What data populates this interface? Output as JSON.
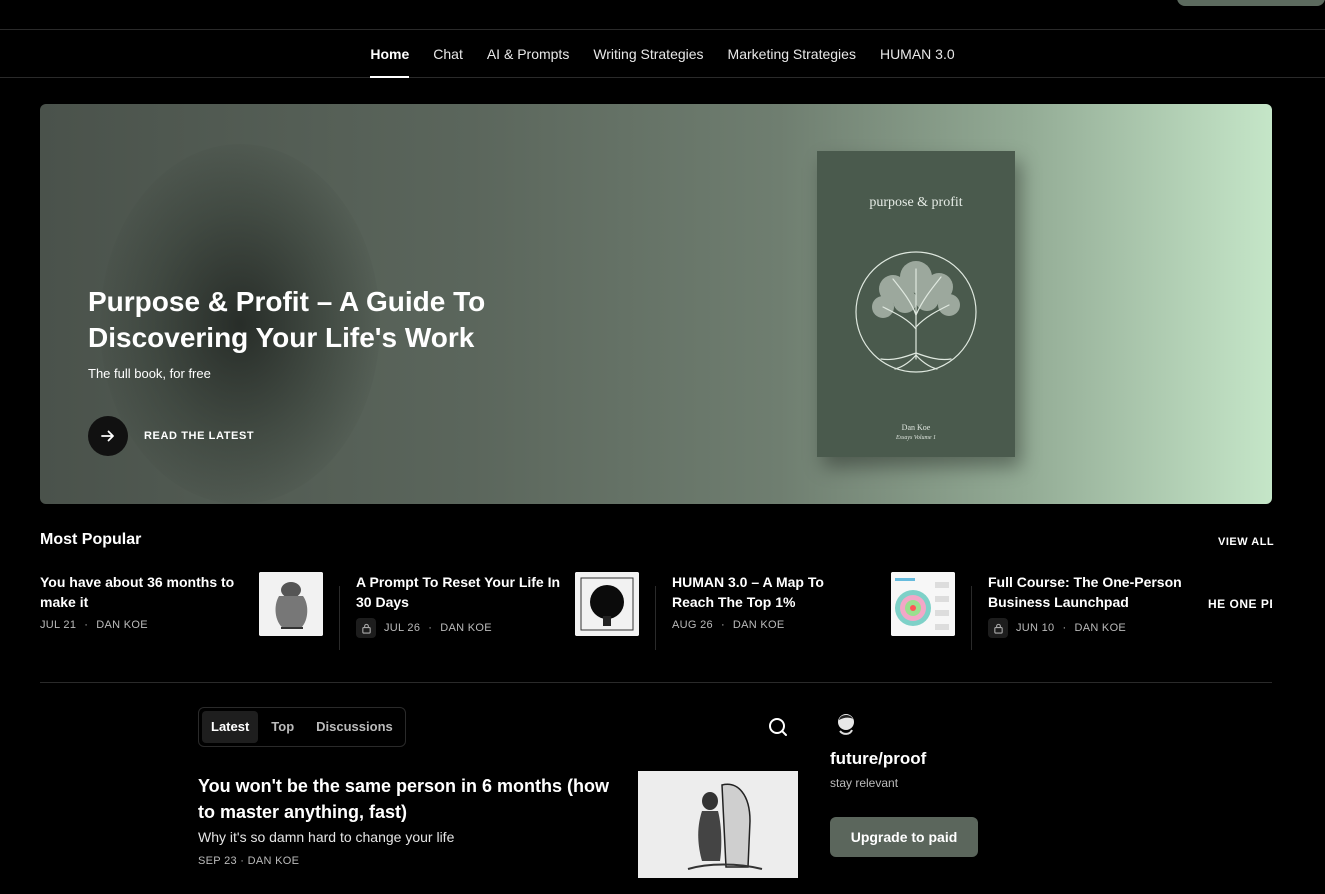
{
  "nav": {
    "tabs": [
      {
        "label": "Home",
        "active": true
      },
      {
        "label": "Chat"
      },
      {
        "label": "AI & Prompts"
      },
      {
        "label": "Writing Strategies"
      },
      {
        "label": "Marketing Strategies"
      },
      {
        "label": "HUMAN 3.0"
      }
    ]
  },
  "hero": {
    "title": "Purpose & Profit – A Guide To Discovering Your Life's Work",
    "subtitle": "The full book, for free",
    "cta": "READ THE LATEST",
    "book": {
      "title": "purpose & profit",
      "author": "Dan Koe",
      "volume": "Essays Volume 1"
    }
  },
  "popular": {
    "heading": "Most Popular",
    "view_all": "VIEW ALL",
    "items": [
      {
        "title": "You have about 36 months to make it",
        "date": "JUL 21",
        "author": "DAN KOE",
        "locked": false
      },
      {
        "title": "A Prompt To Reset Your Life In 30 Days",
        "date": "JUL 26",
        "author": "DAN KOE",
        "locked": true
      },
      {
        "title": "HUMAN 3.0 – A Map To Reach The Top 1%",
        "date": "AUG 26",
        "author": "DAN KOE",
        "locked": false
      },
      {
        "title": "Full Course: The One-Person Business Launchpad",
        "date": "JUN 10",
        "author": "DAN KOE",
        "locked": true,
        "thumb_text": "HE ONE PERSO BUSINES"
      }
    ]
  },
  "feed": {
    "tabs": [
      "Latest",
      "Top",
      "Discussions"
    ],
    "post": {
      "title": "You won't be the same person in 6 months (how to master anything, fast)",
      "subtitle": "Why it's so damn hard to change your life",
      "date": "SEP 23",
      "author": "DAN KOE"
    }
  },
  "publication": {
    "name": "future/proof",
    "tagline": "stay relevant",
    "upgrade": "Upgrade to paid"
  },
  "colors": {
    "accent": "#5b665c",
    "background": "#000000"
  }
}
